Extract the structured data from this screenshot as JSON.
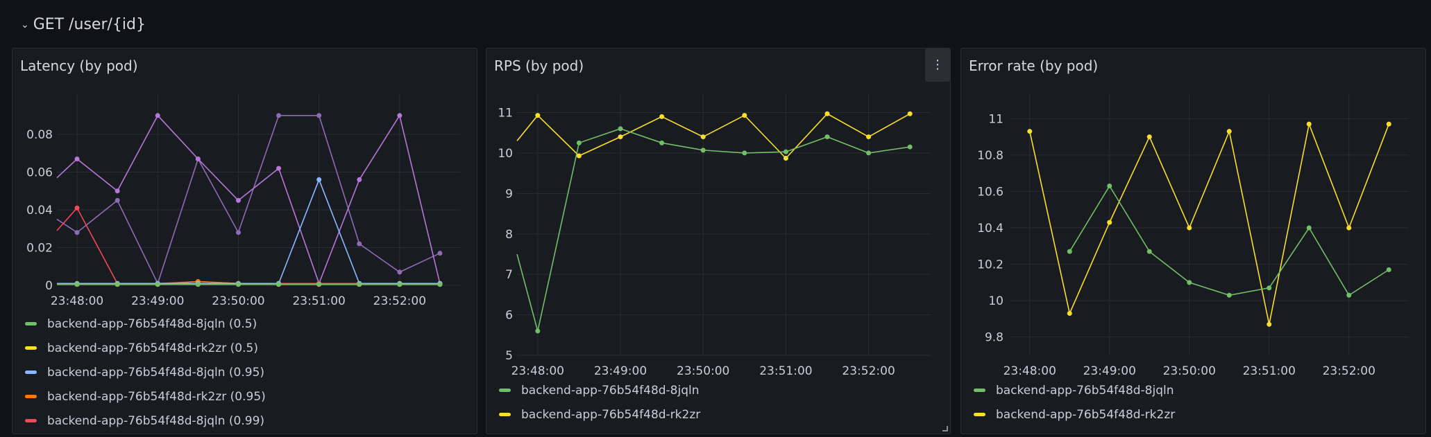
{
  "row": {
    "title": "GET /user/{id}",
    "chevron": "⌄"
  },
  "panels": [
    {
      "title": "Latency (by pod)",
      "chart_data": {
        "type": "line",
        "x": [
          "23:47:45",
          "23:48:00",
          "23:48:30",
          "23:49:00",
          "23:49:30",
          "23:50:00",
          "23:50:30",
          "23:51:00",
          "23:51:30",
          "23:52:00",
          "23:52:30"
        ],
        "xticks": [
          "23:48:00",
          "23:49:00",
          "23:50:00",
          "23:51:00",
          "23:52:00"
        ],
        "yticks": [
          "0",
          "0.02",
          "0.04",
          "0.06",
          "0.08"
        ],
        "ylim": [
          0,
          0.098
        ],
        "series": [
          {
            "name": "backend-app-76b54f48d-8jqln (0.5)",
            "color": "#73bf69",
            "values": [
              0.0005,
              0.0005,
              0.0005,
              0.0005,
              0.0005,
              0.0005,
              0.0005,
              0.0005,
              0.0005,
              0.0005,
              0.0005
            ],
            "in_legend": true
          },
          {
            "name": "backend-app-76b54f48d-rk2zr (0.5)",
            "color": "#fade2a",
            "values": [
              0.0005,
              0.0005,
              0.0005,
              0.0005,
              0.0005,
              0.0005,
              0.0005,
              0.0005,
              0.0005,
              0.0005,
              0.0005
            ],
            "in_legend": true
          },
          {
            "name": "backend-app-76b54f48d-8jqln (0.95)",
            "color": "#8ab8ff",
            "values": [
              0.001,
              0.001,
              0.001,
              0.001,
              0.001,
              0.001,
              0.001,
              0.056,
              0.001,
              0.001,
              0.001
            ],
            "in_legend": true
          },
          {
            "name": "backend-app-76b54f48d-rk2zr (0.95)",
            "color": "#ff780a",
            "values": [
              0.0005,
              0.0005,
              0.0005,
              0.0005,
              0.002,
              0.001,
              0.0005,
              0.0005,
              0.0005,
              0.0005,
              0.0005
            ],
            "in_legend": true
          },
          {
            "name": "backend-app-76b54f48d-8jqln (0.99)",
            "color": "#f2495c",
            "values": [
              0.029,
              0.041,
              0.001,
              0.001,
              0.002,
              0.001,
              0.001,
              0.001,
              0.001,
              0.001,
              0.001
            ],
            "in_legend": true
          },
          {
            "name": "",
            "color": "#b877d9",
            "values": [
              0.057,
              0.067,
              0.05,
              0.09,
              0.067,
              0.045,
              0.062,
              0.001,
              0.056,
              0.09,
              0.001
            ],
            "in_legend": false
          },
          {
            "name": "",
            "color": "#8f6bb8",
            "values": [
              0.035,
              0.028,
              0.045,
              0.001,
              0.067,
              0.028,
              0.09,
              0.09,
              0.022,
              0.007,
              0.017
            ],
            "in_legend": false
          }
        ]
      }
    },
    {
      "title": "RPS (by pod)",
      "menu_icon": "⋮",
      "chart_data": {
        "type": "line",
        "x": [
          "23:47:45",
          "23:48:00",
          "23:48:30",
          "23:49:00",
          "23:49:30",
          "23:50:00",
          "23:50:30",
          "23:51:00",
          "23:51:30",
          "23:52:00",
          "23:52:30"
        ],
        "xticks": [
          "23:48:00",
          "23:49:00",
          "23:50:00",
          "23:51:00",
          "23:52:00"
        ],
        "yticks": [
          "5",
          "6",
          "7",
          "8",
          "9",
          "10",
          "11"
        ],
        "ylim": [
          5,
          11.3
        ],
        "series": [
          {
            "name": "backend-app-76b54f48d-8jqln",
            "color": "#73bf69",
            "values": [
              7.5,
              5.6,
              10.25,
              10.6,
              10.25,
              10.07,
              10.0,
              10.03,
              10.4,
              10.0,
              10.15
            ],
            "in_legend": true
          },
          {
            "name": "backend-app-76b54f48d-rk2zr",
            "color": "#fade2a",
            "values": [
              10.3,
              10.93,
              9.93,
              10.4,
              10.9,
              10.4,
              10.93,
              9.87,
              10.97,
              10.4,
              10.97
            ],
            "in_legend": true
          }
        ]
      }
    },
    {
      "title": "Error rate (by pod)",
      "chart_data": {
        "type": "line",
        "x": [
          "23:48:00",
          "23:48:30",
          "23:49:00",
          "23:49:30",
          "23:50:00",
          "23:50:30",
          "23:51:00",
          "23:51:30",
          "23:52:00",
          "23:52:30"
        ],
        "xticks": [
          "23:48:00",
          "23:49:00",
          "23:50:00",
          "23:51:00",
          "23:52:00"
        ],
        "yticks": [
          "9.8",
          "10",
          "10.2",
          "10.4",
          "10.6",
          "10.8",
          "11"
        ],
        "ylim": [
          9.7,
          11.1
        ],
        "series": [
          {
            "name": "backend-app-76b54f48d-8jqln",
            "color": "#73bf69",
            "values": [
              null,
              10.27,
              10.63,
              10.27,
              10.1,
              10.03,
              10.07,
              10.4,
              10.03,
              10.17
            ],
            "in_legend": true
          },
          {
            "name": "backend-app-76b54f48d-rk2zr",
            "color": "#fade2a",
            "values": [
              10.93,
              9.93,
              10.43,
              10.9,
              10.4,
              10.93,
              9.87,
              10.97,
              10.4,
              10.97
            ],
            "in_legend": true
          }
        ]
      }
    }
  ]
}
